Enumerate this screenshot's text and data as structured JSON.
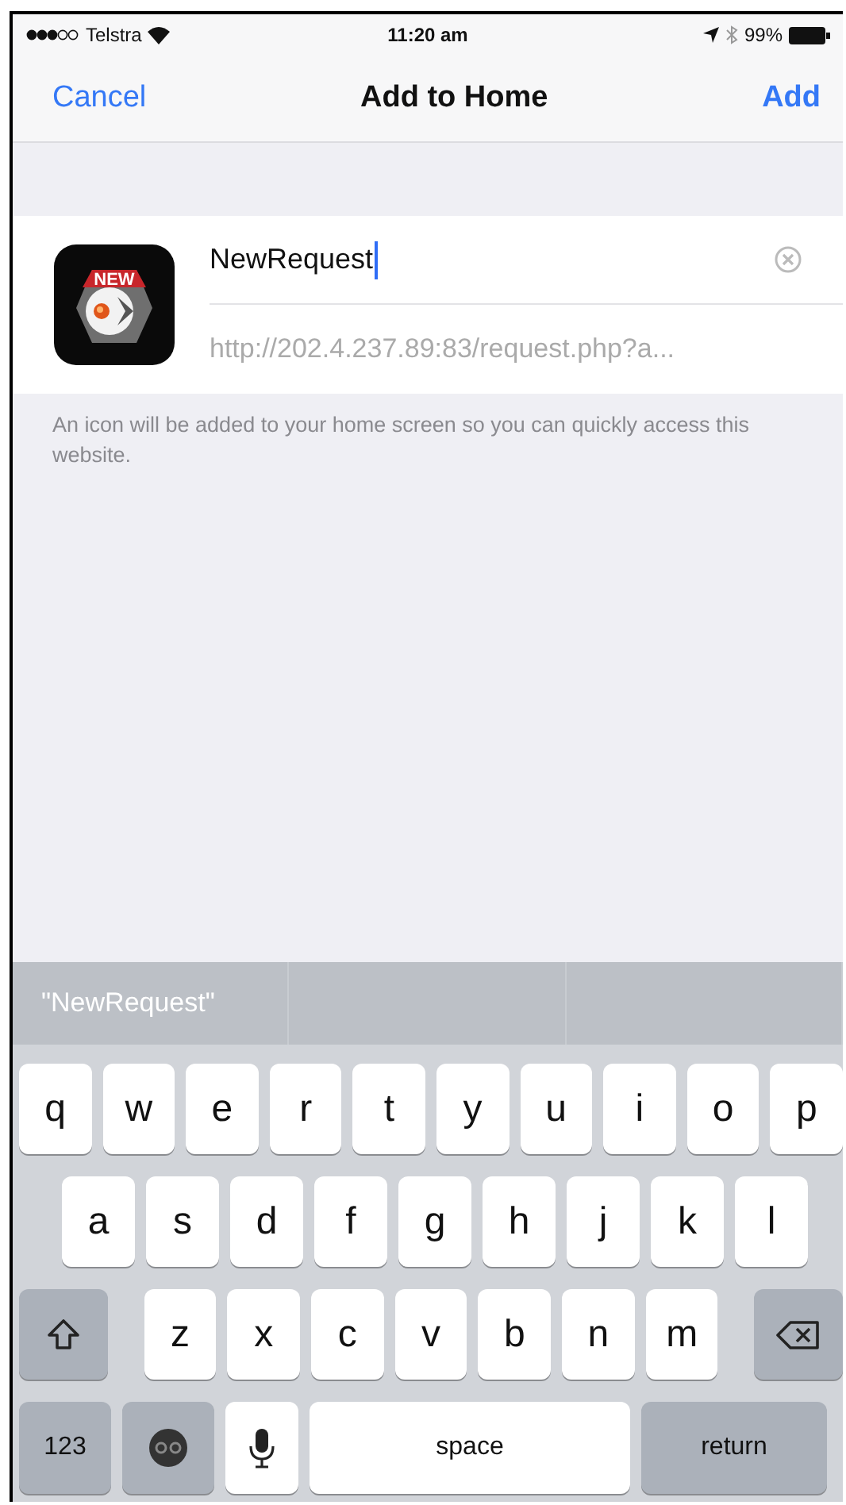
{
  "status_bar": {
    "carrier": "Telstra",
    "time": "11:20 am",
    "battery": "99%"
  },
  "nav": {
    "cancel": "Cancel",
    "title": "Add to Home",
    "add": "Add"
  },
  "app_icon": {
    "badge": "NEW"
  },
  "name_field": {
    "value": "NewRequest",
    "focused": true
  },
  "url": "http://202.4.237.89:83/request.php?a...",
  "note": "An icon will be added to your home screen so you can quickly access this website.",
  "suggestions": [
    "\"NewRequest\""
  ],
  "keyboard": [
    [
      {
        "kind": "letter",
        "label": "q"
      },
      {
        "kind": "letter",
        "label": "w"
      },
      {
        "kind": "letter",
        "label": "e"
      },
      {
        "kind": "letter",
        "label": "r"
      },
      {
        "kind": "letter",
        "label": "t"
      },
      {
        "kind": "letter",
        "label": "y"
      },
      {
        "kind": "letter",
        "label": "u"
      },
      {
        "kind": "letter",
        "label": "i"
      },
      {
        "kind": "letter",
        "label": "o"
      },
      {
        "kind": "letter",
        "label": "p"
      }
    ],
    [
      {
        "kind": "letter",
        "label": "a"
      },
      {
        "kind": "letter",
        "label": "s"
      },
      {
        "kind": "letter",
        "label": "d"
      },
      {
        "kind": "letter",
        "label": "f"
      },
      {
        "kind": "letter",
        "label": "g"
      },
      {
        "kind": "letter",
        "label": "h"
      },
      {
        "kind": "letter",
        "label": "j"
      },
      {
        "kind": "letter",
        "label": "k"
      },
      {
        "kind": "letter",
        "label": "l"
      }
    ],
    [
      {
        "kind": "shift"
      },
      {
        "kind": "letter",
        "label": "z"
      },
      {
        "kind": "letter",
        "label": "x"
      },
      {
        "kind": "letter",
        "label": "c"
      },
      {
        "kind": "letter",
        "label": "v"
      },
      {
        "kind": "letter",
        "label": "b"
      },
      {
        "kind": "letter",
        "label": "n"
      },
      {
        "kind": "letter",
        "label": "m"
      },
      {
        "kind": "delete"
      }
    ],
    [
      {
        "kind": "mode",
        "label": "123"
      },
      {
        "kind": "emoji"
      },
      {
        "kind": "mic"
      },
      {
        "kind": "space",
        "label": "space"
      },
      {
        "kind": "return",
        "label": "return"
      }
    ]
  ]
}
